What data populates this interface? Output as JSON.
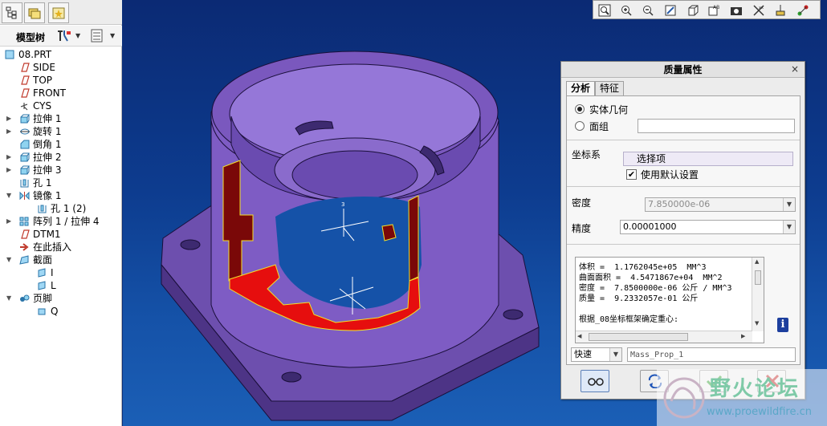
{
  "model_tree": {
    "title": "模型树",
    "items": [
      {
        "label": "08.PRT",
        "icon": "part-icon"
      },
      {
        "label": "SIDE",
        "icon": "datum-plane-icon"
      },
      {
        "label": "TOP",
        "icon": "datum-plane-icon"
      },
      {
        "label": "FRONT",
        "icon": "datum-plane-icon"
      },
      {
        "label": "CYS",
        "icon": "coordinate-system-icon"
      },
      {
        "label": "拉伸 1",
        "icon": "extrude-icon"
      },
      {
        "label": "旋转 1",
        "icon": "revolve-icon"
      },
      {
        "label": "倒角 1",
        "icon": "chamfer-icon"
      },
      {
        "label": "拉伸 2",
        "icon": "extrude-icon"
      },
      {
        "label": "拉伸 3",
        "icon": "extrude-icon"
      },
      {
        "label": "孔 1",
        "icon": "hole-icon"
      },
      {
        "label": "镜像 1",
        "icon": "mirror-icon"
      },
      {
        "label": "孔 1 (2)",
        "icon": "hole-icon"
      },
      {
        "label": "阵列 1 / 拉伸 4",
        "icon": "pattern-icon"
      },
      {
        "label": "DTM1",
        "icon": "datum-plane-icon"
      },
      {
        "label": "在此插入",
        "icon": "insert-here-arrow-icon"
      },
      {
        "label": "截面",
        "icon": "sections-icon"
      },
      {
        "label": "I",
        "icon": "section-icon"
      },
      {
        "label": "L",
        "icon": "section-icon"
      },
      {
        "label": "页脚",
        "icon": "footer-icon"
      },
      {
        "label": "Q",
        "icon": "footer-item-icon"
      }
    ]
  },
  "toolbar": {
    "buttons": [
      "zoom-window-icon",
      "zoom-in-icon",
      "zoom-out-icon",
      "repaint-icon",
      "orient-icon",
      "named-views-icon",
      "spin-center-icon",
      "datum-display-icon",
      "annotation-display-icon",
      "axis-display-icon"
    ]
  },
  "dialog": {
    "title": "质量属性",
    "close_label": "×",
    "tabs": [
      "分析",
      "特征"
    ],
    "radio_solid": "实体几何",
    "radio_quilt": "面组",
    "csys_label": "坐标系",
    "csys_value": "选择项",
    "use_default": "使用默认设置",
    "density_label": "密度",
    "density_value": "7.850000e-06",
    "accuracy_label": "精度",
    "accuracy_value": "0.00001000",
    "results": [
      "体积 =  1.1762045e+05  MM^3",
      "曲面面积 =  4.5471867e+04  MM^2",
      "密度 =  7.8500000e-06 公斤 / MM^3",
      "质量 =  9.2332057e-01 公斤",
      "",
      "根据_08坐标框架确定重心:"
    ],
    "mode_value": "快速",
    "name_value": "Mass_Prop_1",
    "info_icon": "i"
  },
  "watermark": {
    "text": "野火论坛",
    "url": "www.proewildfire.cn"
  },
  "colors": {
    "part": "#7e5cc4",
    "section_cut": "#7a0808",
    "section_fill": "#e60e0e",
    "accent_green": "#2f9d2f",
    "accent_red": "#c02020"
  }
}
